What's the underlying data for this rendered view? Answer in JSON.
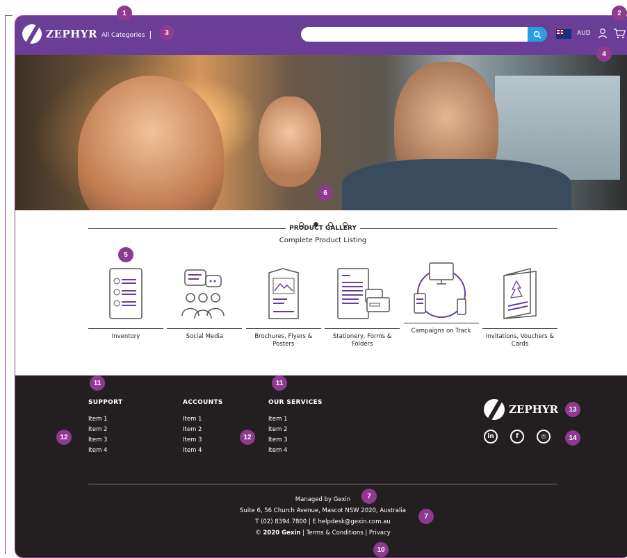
{
  "header": {
    "brand": "ZEPHYR",
    "categories_label": "All Categories",
    "separator": "|",
    "search_placeholder": "",
    "currency": "AUD",
    "flag_icon": "australia-flag-icon",
    "accent_color": "#6a3d96",
    "search_button_color": "#27a0e0"
  },
  "hero": {
    "carousel_dots": 4,
    "active_dot": 2
  },
  "gallery": {
    "title": "PRODUCT GALLERY",
    "subtitle": "Complete Product Listing",
    "products": [
      {
        "label": "Inventory",
        "icon": "inventory-icon"
      },
      {
        "label": "Social Media",
        "icon": "social-media-icon"
      },
      {
        "label": "Brochures, Flyers & Posters",
        "icon": "brochure-icon"
      },
      {
        "label": "Stationery, Forms & Folders",
        "icon": "stationery-icon"
      },
      {
        "label": "Campaigns on Track",
        "icon": "campaigns-icon"
      },
      {
        "label": "Invitations, Vouchers & Cards",
        "icon": "invitation-card-icon"
      }
    ]
  },
  "footer": {
    "columns": [
      {
        "heading": "SUPPORT",
        "items": [
          "Item 1",
          "Item 2",
          "Item 3",
          "Item 4"
        ]
      },
      {
        "heading": "ACCOUNTS",
        "items": [
          "Item 1",
          "Item 2",
          "Item 3",
          "Item 4"
        ]
      },
      {
        "heading": "OUR SERVICES",
        "items": [
          "Item 1",
          "Item 2",
          "Item 3",
          "Item 4"
        ]
      }
    ],
    "brand": "ZEPHYR",
    "social": [
      {
        "name": "linkedin-icon",
        "glyph": "in"
      },
      {
        "name": "facebook-icon",
        "glyph": "f"
      },
      {
        "name": "instagram-icon",
        "glyph": "◎"
      }
    ],
    "managed_by": "Managed by Gexin",
    "address": "Suite 6, 56 Church Avenue, Mascot NSW 2020, Australia",
    "contact": "T (02) 8394 7800 | E helpdesk@gexin.com.au",
    "copyright_symbol": "©",
    "copyright_year_company": "2020 Gexin",
    "terms": "Terms & Conditions",
    "privacy": "Privacy",
    "background_color": "#231f20"
  },
  "annotations": {
    "badge_color": "#8e3a8e",
    "labels": [
      "1",
      "2",
      "3",
      "4",
      "5",
      "6",
      "7",
      "7",
      "10",
      "11",
      "11",
      "12",
      "12",
      "13",
      "14"
    ]
  }
}
